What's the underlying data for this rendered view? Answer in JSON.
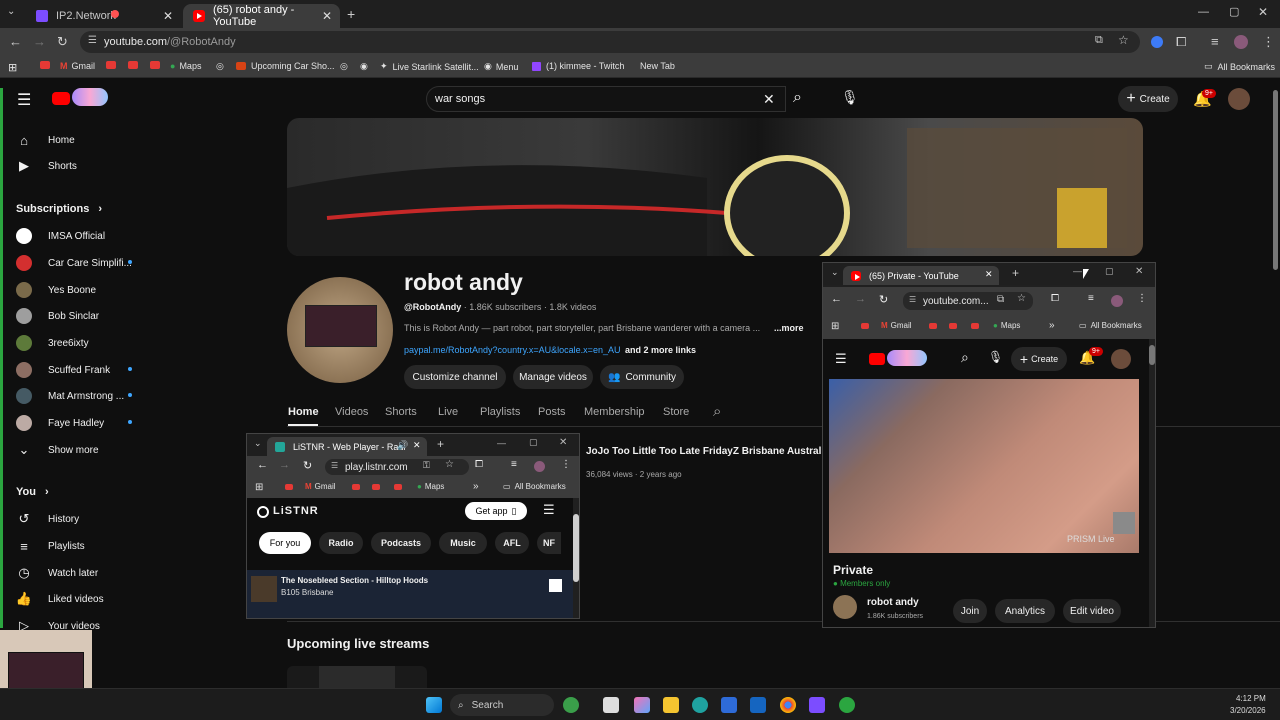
{
  "browser": {
    "tabs": [
      {
        "label": "IP2.Network"
      },
      {
        "label": "(65) robot andy - YouTube"
      }
    ],
    "url_host": "youtube.com",
    "url_path": "/@RobotAndy",
    "bookmarks": [
      "Gmail",
      "Maps",
      "Upcoming Car Sho...",
      "Live Starlink Satellit...",
      "Menu",
      "(1) kimmee - Twitch",
      "New Tab"
    ],
    "all_bookmarks": "All Bookmarks"
  },
  "youtube": {
    "search_value": "war songs",
    "create_label": "Create",
    "notif_badge": "9+",
    "sidebar": {
      "home": "Home",
      "shorts": "Shorts",
      "subscriptions": "Subscriptions",
      "subs": [
        "IMSA Official",
        "Car Care Simplifi...",
        "Yes Boone",
        "Bob Sinclar",
        "3ree6ixty",
        "Scuffed Frank",
        "Mat Armstrong ...",
        "Faye Hadley"
      ],
      "show_more": "Show more",
      "you": "You",
      "you_items": [
        "History",
        "Playlists",
        "Watch later",
        "Liked videos",
        "Your videos"
      ]
    },
    "channel": {
      "name": "robot andy",
      "handle": "@RobotAndy",
      "subs": "· 1.86K subscribers",
      "videos": "· 1.8K videos",
      "description": "This is Robot Andy — part robot, part storyteller, part Brisbane wanderer with a camera ...",
      "more": "...more",
      "link": "paypal.me/RobotAndy?country.x=AU&locale.x=en_AU",
      "more_links": "and 2 more links",
      "buttons": {
        "customize": "Customize channel",
        "manage": "Manage videos",
        "community": "Community"
      },
      "tabs": [
        "Home",
        "Videos",
        "Shorts",
        "Live",
        "Playlists",
        "Posts",
        "Membership",
        "Store"
      ]
    },
    "featured": {
      "title": "JoJo Too Little Too Late FridayZ Brisbane Australia 2023",
      "meta": "36,084 views · 2 years ago"
    },
    "upcoming": "Upcoming live streams"
  },
  "listnr_window": {
    "tab": "LiSTNR - Web Player - Radi",
    "url": "play.listnr.com",
    "bookmarks": [
      "Gmail",
      "Maps"
    ],
    "all_bookmarks": "All Bookmarks",
    "logo": "LiSTNR",
    "get_app": "Get app",
    "chips": [
      "For you",
      "Radio",
      "Podcasts",
      "Music",
      "AFL",
      "NF"
    ],
    "now_playing_title": "The Nosebleed Section - Hilltop Hoods",
    "now_playing_station": "B105 Brisbane"
  },
  "private_window": {
    "tab": "(65) Private - YouTube",
    "url": "youtube.com...",
    "bookmarks": [
      "Gmail",
      "Maps"
    ],
    "all_bookmarks": "All Bookmarks",
    "create_label": "Create",
    "notif_badge": "9+",
    "watermark": "PRISM Live",
    "video_title": "Private",
    "members_only": "Members only",
    "channel": "robot andy",
    "subs": "1.86K subscribers",
    "join": "Join",
    "analytics": "Analytics",
    "edit": "Edit video"
  },
  "taskbar": {
    "search": "Search",
    "time": "4:12 PM",
    "date": "3/20/2026"
  },
  "colors": {
    "yt_red": "#ff0000",
    "link_blue": "#3ea6ff",
    "bg": "#0f0f0f",
    "chip": "#272727",
    "members_green": "#2ba640"
  }
}
